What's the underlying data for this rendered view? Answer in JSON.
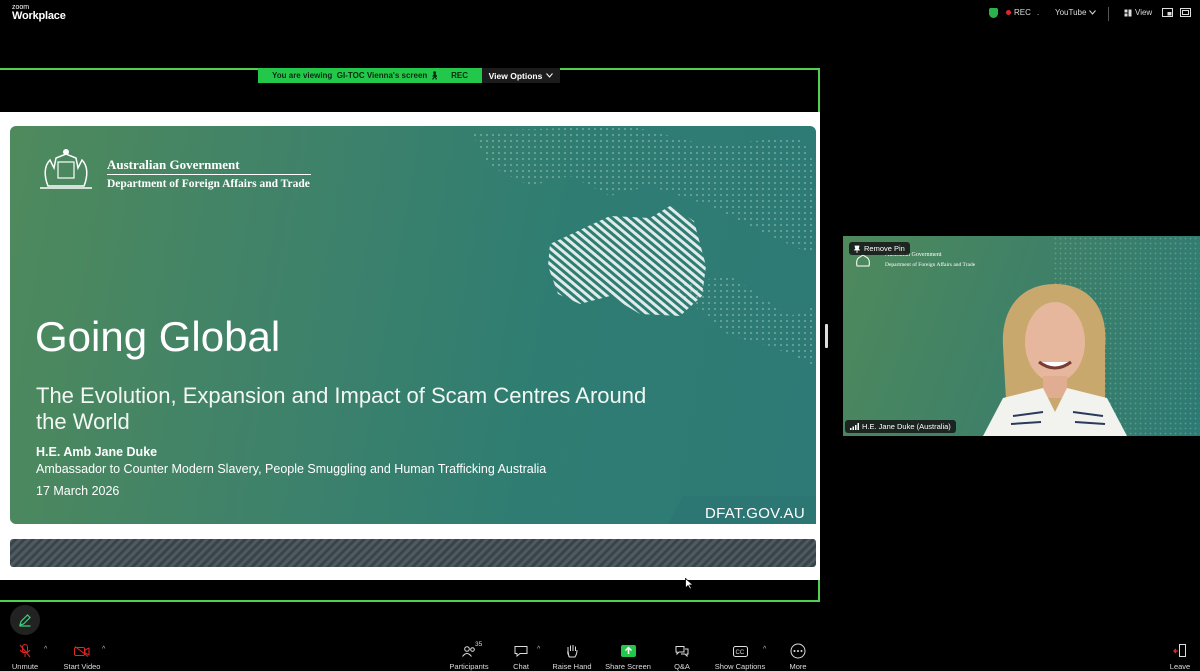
{
  "app": {
    "logo_small": "zoom",
    "logo_big": "Workplace"
  },
  "topbar": {
    "rec": "REC",
    "dot": ".",
    "youtube": "YouTube",
    "view": "View"
  },
  "share": {
    "viewing_prefix": "You are viewing",
    "viewing_name": "GI-TOC Vienna's screen",
    "viewing_rec": "REC",
    "view_options": "View Options"
  },
  "slide": {
    "gov_title": "Australian Government",
    "gov_dept": "Department of Foreign Affairs and Trade",
    "title": "Going Global",
    "subtitle": "The Evolution, Expansion and Impact of Scam Centres Around the World",
    "speaker": "H.E. Amb Jane Duke",
    "role": "Ambassador to Counter Modern Slavery, People Smuggling and Human Trafficking Australia",
    "date": "17 March 2026",
    "website": "DFAT.GOV.AU"
  },
  "video": {
    "remove_pin": "Remove Pin",
    "gov_title": "Australian Government",
    "gov_dept": "Department of Foreign Affairs and Trade",
    "participant_name": "H.E. Jane Duke (Australia)"
  },
  "toolbar": {
    "unmute": "Unmute",
    "start_video": "Start Video",
    "participants": "Participants",
    "participants_count": "35",
    "chat": "Chat",
    "raise_hand": "Raise Hand",
    "share_screen": "Share Screen",
    "qa": "Q&A",
    "show_captions": "Show Captions",
    "more": "More",
    "leave": "Leave"
  },
  "colors": {
    "accent_green": "#23c84a",
    "frame_green": "#4fd04f",
    "leave_red": "#e02828",
    "slide_teal": "#2d7a76"
  }
}
